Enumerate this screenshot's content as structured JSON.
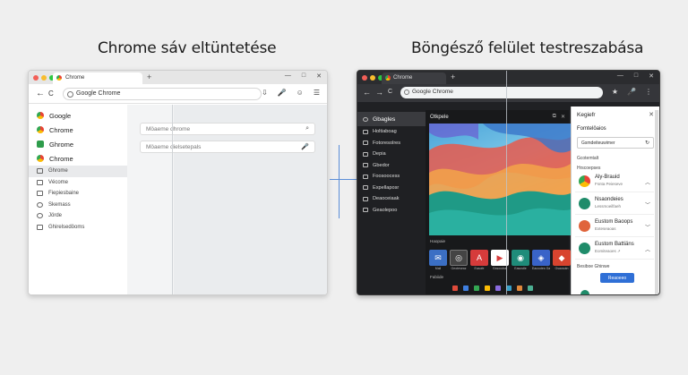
{
  "headings": {
    "left": "Chrome sáv eltüntetése",
    "right": "Böngésző felület testreszabása"
  },
  "light_window": {
    "tab_title": "Chrome",
    "new_tab": "+",
    "window_controls": [
      "—",
      "□",
      "✕"
    ],
    "address": "Google Chrome",
    "nav": [
      "←",
      "→",
      "C"
    ],
    "toolbar_icons": [
      "⇩",
      "🎤",
      "☺",
      "☰"
    ],
    "sidebar_large": [
      {
        "label": "Google",
        "icon": "chrome-icon"
      },
      {
        "label": "Chrome",
        "icon": "chrome-icon"
      },
      {
        "label": "Ghrome",
        "icon": "green-icon"
      },
      {
        "label": "Chrome",
        "icon": "chrome-icon"
      }
    ],
    "sidebar_small": [
      "Ghrome",
      "Vécome",
      "Fiepiesbaine",
      "Skemass",
      "Jörde",
      "Ghirelsedöoms"
    ],
    "inputs": [
      {
        "value": "Möaeme dhrome",
        "icon": "search-icon",
        "glyph": "⌕"
      },
      {
        "value": "Möaeme dielsetepals",
        "icon": "mic-icon",
        "glyph": "🎤"
      }
    ]
  },
  "dark_window": {
    "tab_title": "Chrome",
    "new_tab": "+",
    "window_controls": [
      "—",
      "□",
      "✕"
    ],
    "address": "Google Chrome",
    "nav": [
      "←",
      "→",
      "C"
    ],
    "toolbar_icons": [
      "★",
      "🎤",
      "⋮"
    ],
    "sidebar": [
      "Gbagles",
      "Holtiaboag",
      "Fotoresolres",
      "Depia",
      "Gbedor",
      "Foosoocess",
      "Expellaposr",
      "Deaoceiaak",
      "Geaolepoo"
    ],
    "main_title": "Otkpele",
    "main_controls": [
      "⧉",
      "✕"
    ],
    "section_label": "Haopaie",
    "section_label2": "Fabiide",
    "tiles": [
      {
        "label": "Mail",
        "color": "#3b6fc4",
        "glyph": "✉"
      },
      {
        "label": "Geoteseaz",
        "color": "#444",
        "glyph": "◎"
      },
      {
        "label": "Easofe",
        "color": "#d63b3b",
        "glyph": "A"
      },
      {
        "label": "Easoodse",
        "color": "#ffffff",
        "glyph": "▶"
      },
      {
        "label": "Easostle",
        "color": "#1f8c7a",
        "glyph": "◉"
      },
      {
        "label": "Eacootes Gameeuse",
        "color": "#3963c8",
        "glyph": "◈"
      },
      {
        "label": "Gsaosotn",
        "color": "#d8442f",
        "glyph": "◆"
      }
    ],
    "taskbar_colors": [
      "#e04b3b",
      "#3f7fe0",
      "#34a853",
      "#fbbc05",
      "#8a6be0",
      "#39a0c8",
      "#e0883b",
      "#4caf93"
    ]
  },
  "panel": {
    "title": "Kegiefr",
    "close": "✕",
    "subtitle": "Fomtelöaios",
    "field": "Gsmdeiteuwimer",
    "field_icon": "↻",
    "caption1": "Gcotemtalt",
    "caption2": "Hrscoepses",
    "extensions": [
      {
        "name": "Aly-Brauid",
        "sub": "Fsnta Peieseve",
        "color": "#d94b3b"
      },
      {
        "name": "Nsaondeies",
        "sub": "Lessmoeilfaeh",
        "color": "#1f8c6a"
      },
      {
        "name": "Eustom Baoops",
        "sub": "Exteseaoas",
        "color": "#e0643b"
      },
      {
        "name": "Eustom Battiäns",
        "sub": "Eomiteaoes ↗",
        "color": "#1f8c6a"
      }
    ],
    "footer_label": "Besiboe Ghinwe",
    "button": "Reaoeeo"
  }
}
